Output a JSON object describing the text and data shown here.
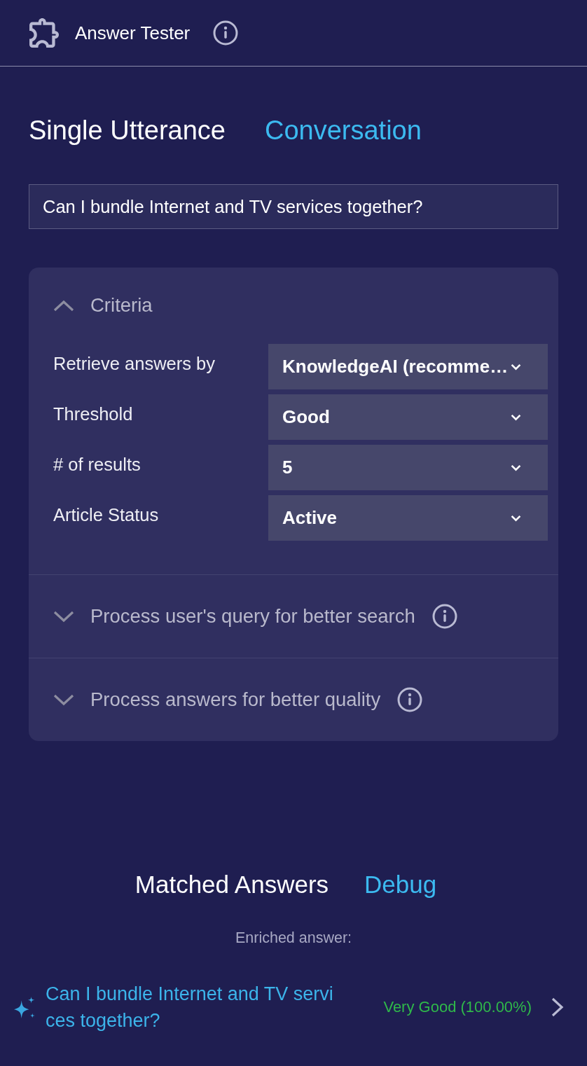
{
  "header": {
    "title": "Answer Tester"
  },
  "mode_tabs": [
    {
      "label": "Single Utterance",
      "selected": true
    },
    {
      "label": "Conversation",
      "selected": false
    }
  ],
  "query": {
    "value": "Can I bundle Internet and TV services together?"
  },
  "sections": [
    {
      "title": "Criteria",
      "expanded": true,
      "info": false,
      "fields": [
        {
          "label": "Retrieve answers by",
          "value": "KnowledgeAI (recomme…"
        },
        {
          "label": "Threshold",
          "value": "Good"
        },
        {
          "label": "# of results",
          "value": "5"
        },
        {
          "label": "Article Status",
          "value": "Active"
        }
      ]
    },
    {
      "title": "Process user's query for better search",
      "expanded": false,
      "info": true
    },
    {
      "title": "Process answers for better quality",
      "expanded": false,
      "info": true
    }
  ],
  "result_tabs": [
    {
      "label": "Matched Answers",
      "selected": true
    },
    {
      "label": "Debug",
      "selected": false
    }
  ],
  "enriched_label": "Enriched answer:",
  "answers": [
    {
      "title": "Can I bundle Internet and TV services together?",
      "score": "Very Good (100.00%)"
    }
  ]
}
